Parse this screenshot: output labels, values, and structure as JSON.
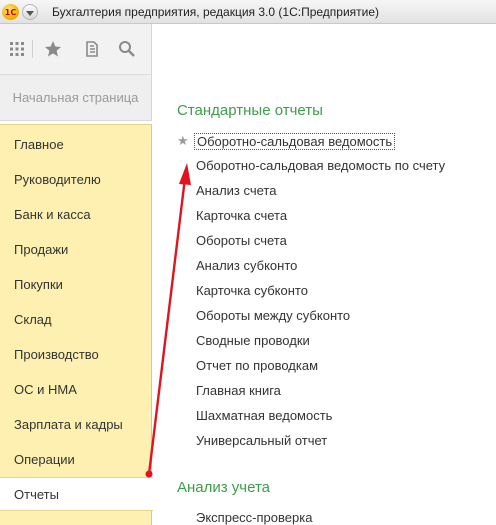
{
  "window": {
    "title": "Бухгалтерия предприятия, редакция 3.0  (1С:Предприятие)",
    "logo_text": "1С"
  },
  "toolbar": {
    "icons": [
      "apps-grid-icon",
      "favorites-star-icon",
      "history-icon",
      "search-icon"
    ]
  },
  "home_tab": {
    "label": "Начальная страница"
  },
  "sidebar": {
    "items": [
      {
        "label": "Главное"
      },
      {
        "label": "Руководителю"
      },
      {
        "label": "Банк и касса"
      },
      {
        "label": "Продажи"
      },
      {
        "label": "Покупки"
      },
      {
        "label": "Склад"
      },
      {
        "label": "Производство"
      },
      {
        "label": "ОС и НМА"
      },
      {
        "label": "Зарплата и кадры"
      },
      {
        "label": "Операции"
      },
      {
        "label": "Отчеты",
        "active": true
      }
    ]
  },
  "main": {
    "sections": [
      {
        "title": "Стандартные отчеты",
        "links": [
          {
            "label": "Оборотно-сальдовая ведомость",
            "favorite": true,
            "focused": true
          },
          {
            "label": "Оборотно-сальдовая ведомость по счету"
          },
          {
            "label": "Анализ счета"
          },
          {
            "label": "Карточка счета"
          },
          {
            "label": "Обороты счета"
          },
          {
            "label": "Анализ субконто"
          },
          {
            "label": "Карточка субконто"
          },
          {
            "label": "Обороты между субконто"
          },
          {
            "label": "Сводные проводки"
          },
          {
            "label": "Отчет по проводкам"
          },
          {
            "label": "Главная книга"
          },
          {
            "label": "Шахматная ведомость"
          },
          {
            "label": "Универсальный отчет"
          }
        ]
      },
      {
        "title": "Анализ учета",
        "links": [
          {
            "label": "Экспресс-проверка"
          }
        ]
      }
    ]
  },
  "colors": {
    "section_header": "#3c9e4a",
    "sidebar_bg": "#fdf0b1",
    "annotation_arrow": "#e0141e"
  }
}
